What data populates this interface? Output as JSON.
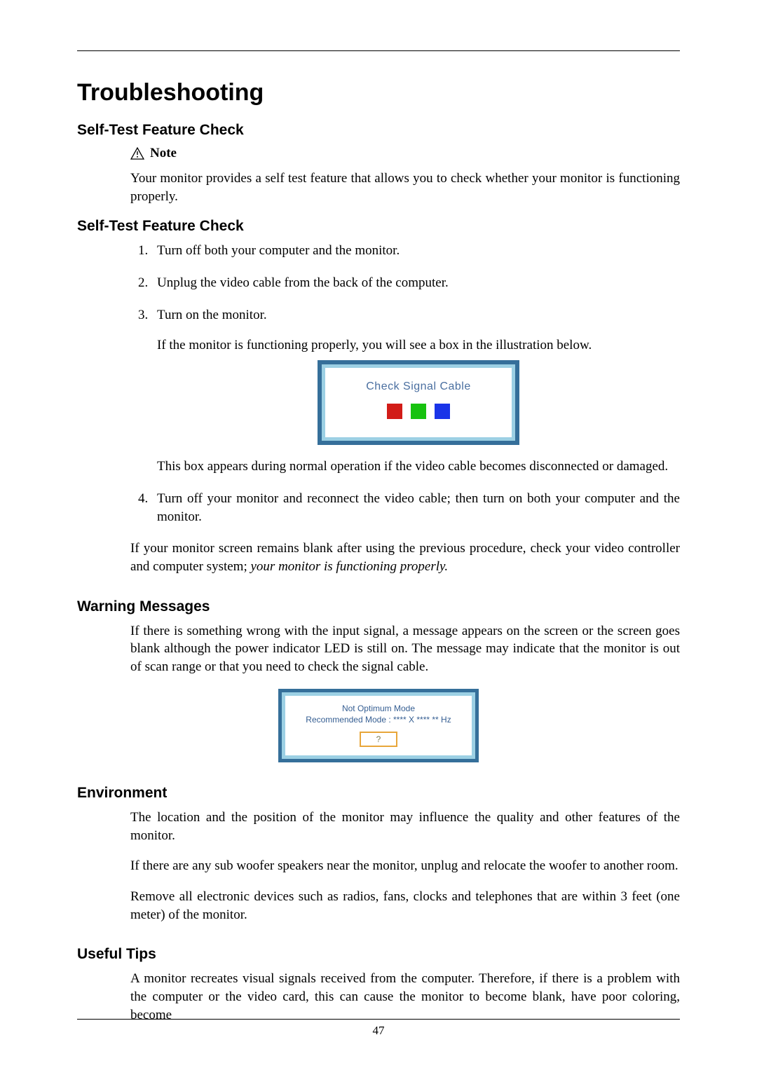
{
  "page_number": "47",
  "title": "Troubleshooting",
  "sec1": {
    "heading": "Self-Test Feature Check",
    "note_label": "Note",
    "p1": "Your monitor provides a self test feature that allows you to check whether your monitor is functioning properly."
  },
  "sec2": {
    "heading": "Self-Test Feature Check",
    "step1": "Turn off both your computer and the monitor.",
    "step2": "Unplug the video cable from the back of the computer.",
    "step3": "Turn on the monitor.",
    "step3_sub": "If the monitor is functioning properly, you will see a box in the illustration below.",
    "box_label": "Check Signal Cable",
    "step3_after": "This box appears during normal operation if the video cable becomes disconnected or damaged.",
    "step4": "Turn off your monitor and reconnect the video cable; then turn on both your computer and the monitor.",
    "closing_a": "If your monitor screen remains blank after using the previous procedure, check your video controller and computer system; ",
    "closing_b_italic": "your monitor is functioning properly."
  },
  "sec3": {
    "heading": "Warning Messages",
    "p1": "If there is something wrong with the input signal, a message appears on the screen or the screen goes blank although the power indicator LED is still on. The message may indicate that the monitor is out of scan range or that you need to check the signal cable.",
    "box_line1": "Not Optimum Mode",
    "box_line2": "Recommended Mode : **** X **** ** Hz",
    "box_btn": "?"
  },
  "sec4": {
    "heading": "Environment",
    "p1": "The location and the position of the monitor may influence the quality and other features of the monitor.",
    "p2": "If there are any sub woofer speakers near the monitor, unplug and relocate the woofer to another room.",
    "p3": "Remove all electronic devices such as radios, fans, clocks and telephones that are within 3 feet (one meter) of the monitor."
  },
  "sec5": {
    "heading": "Useful Tips",
    "p1": "A monitor recreates visual signals received from the computer. Therefore, if there is a problem with the computer or the video card, this can cause the monitor to become blank, have poor coloring, become"
  }
}
